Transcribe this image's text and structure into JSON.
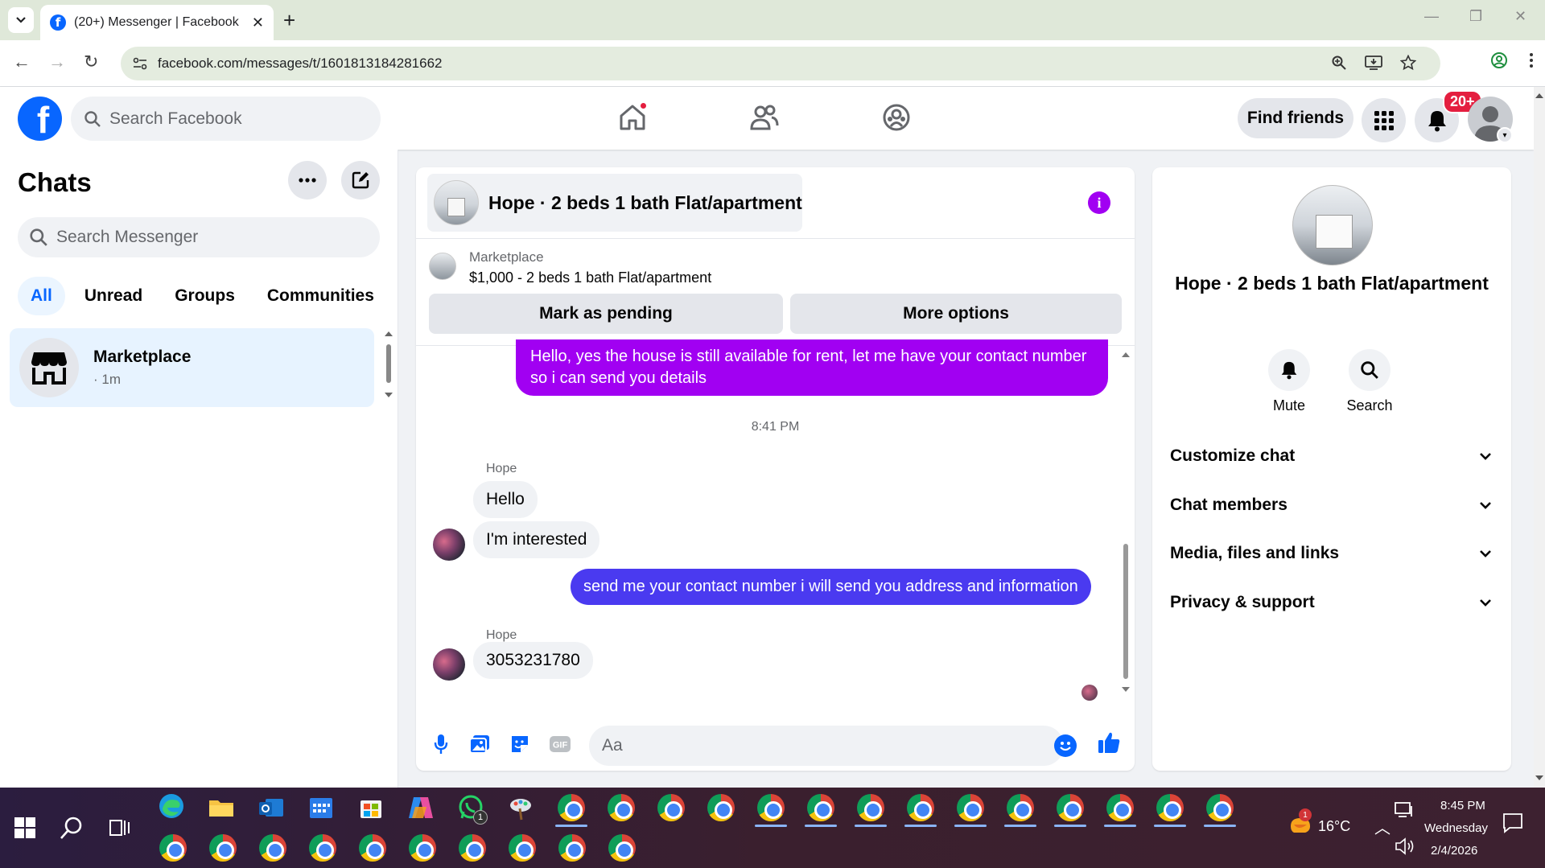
{
  "browser": {
    "tab_title": "(20+) Messenger | Facebook",
    "url": "facebook.com/messages/t/1601813184281662",
    "new_tab_label": "+"
  },
  "header": {
    "search_placeholder": "Search Facebook",
    "find_friends_label": "Find friends",
    "notification_badge": "20+"
  },
  "sidebar": {
    "title": "Chats",
    "search_placeholder": "Search Messenger",
    "filters": [
      {
        "label": "All",
        "active": true
      },
      {
        "label": "Unread",
        "active": false
      },
      {
        "label": "Groups",
        "active": false
      },
      {
        "label": "Communities",
        "active": false
      }
    ],
    "chats": [
      {
        "name": "Marketplace",
        "subtitle": "· 1m",
        "icon": "store-icon"
      }
    ]
  },
  "conversation": {
    "title": "Hope · 2 beds 1 bath Flat/apartment",
    "marketplace_label": "Marketplace",
    "listing": "$1,000 - 2 beds 1 bath Flat/apartment",
    "mark_pending_label": "Mark as pending",
    "more_options_label": "More options",
    "messages": {
      "out1": "Hello, yes the house is still available for rent, let me have your contact number so i can send you details",
      "timestamp": "8:41 PM",
      "sender1": "Hope",
      "in1": "Hello",
      "in2": "I'm interested",
      "out2": "send me your contact number i will send you address and information",
      "sender2": "Hope",
      "in3": "3053231780"
    },
    "composer_placeholder": "Aa",
    "gif_label": "GIF",
    "colors": {
      "out1": "#a100f2",
      "out2": "#4a3af0",
      "accent": "#0866ff"
    }
  },
  "details": {
    "name": "Hope · 2 beds 1 bath Flat/apartment",
    "actions": [
      {
        "label": "Mute",
        "icon": "bell-icon"
      },
      {
        "label": "Search",
        "icon": "search-icon"
      }
    ],
    "sections": [
      "Customize chat",
      "Chat members",
      "Media, files and links",
      "Privacy & support"
    ]
  },
  "taskbar": {
    "temperature": "16°C",
    "weather_badge": "1",
    "whatsapp_badge": "1",
    "time": "8:45 PM",
    "day": "Wednesday",
    "date": "2/4/2026"
  }
}
